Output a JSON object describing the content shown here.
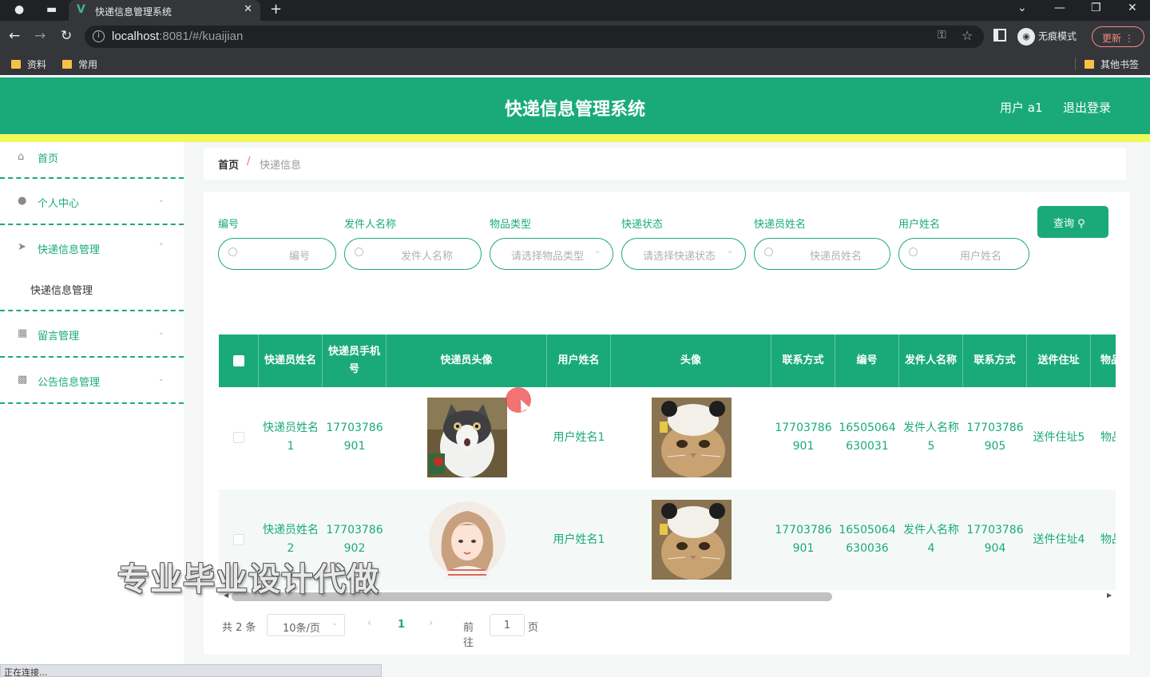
{
  "browser": {
    "tab_title": "快递信息管理系统",
    "tab_icon": "vue-logo-icon",
    "new_tab": "+",
    "url_host": "localhost",
    "url_rest": ":8081/#/kuaijian",
    "incognito_label": "无痕模式",
    "update_label": "更新",
    "bookmarks": [
      "资料",
      "常用"
    ],
    "other_bookmarks": "其他书签",
    "status_text": "正在连接..."
  },
  "app": {
    "title": "快递信息管理系统",
    "user_label": "用户 a1",
    "logout_label": "退出登录",
    "accent_color": "#1aaa7a",
    "highlight_color": "#f1f85a"
  },
  "sidebar": {
    "items": [
      {
        "label": "首页",
        "icon": "home-icon"
      },
      {
        "label": "个人中心",
        "icon": "user-icon"
      },
      {
        "label": "快递信息管理",
        "icon": "send-icon"
      },
      {
        "label": "留言管理",
        "icon": "chat-icon"
      },
      {
        "label": "公告信息管理",
        "icon": "notice-icon"
      }
    ],
    "sub_item": "快递信息管理"
  },
  "breadcrumb": {
    "home": "首页",
    "separator": "/",
    "current": "快递信息"
  },
  "filters": [
    {
      "label": "编号",
      "placeholder": "编号",
      "type": "input"
    },
    {
      "label": "发件人名称",
      "placeholder": "发件人名称",
      "type": "input"
    },
    {
      "label": "物品类型",
      "placeholder": "请选择物品类型",
      "type": "select"
    },
    {
      "label": "快递状态",
      "placeholder": "请选择快递状态",
      "type": "select"
    },
    {
      "label": "快递员姓名",
      "placeholder": "快递员姓名",
      "type": "input"
    },
    {
      "label": "用户姓名",
      "placeholder": "用户姓名",
      "type": "input"
    }
  ],
  "search_button": "查询",
  "table": {
    "headers": [
      "快递员姓名",
      "快递员手机号",
      "快递员头像",
      "用户姓名",
      "头像",
      "联系方式",
      "编号",
      "发件人名称",
      "联系方式",
      "送件住址",
      "物品"
    ],
    "rows": [
      {
        "courier_name": "快递员姓名1",
        "courier_phone": "17703786901",
        "courier_avatar": "cat-photo",
        "user_name": "用户姓名1",
        "avatar": "cat-with-hat-photo",
        "contact": "17703786901",
        "number": "16505064630031",
        "sender": "发件人名称5",
        "sender_contact": "17703786905",
        "address": "送件住址5",
        "item": "物品"
      },
      {
        "courier_name": "快递员姓名2",
        "courier_phone": "17703786902",
        "courier_avatar": "anime-girl-portrait",
        "user_name": "用户姓名1",
        "avatar": "cat-with-hat-photo",
        "contact": "17703786901",
        "number": "16505064630036",
        "sender": "发件人名称4",
        "sender_contact": "17703786904",
        "address": "送件住址4",
        "item": "物品"
      }
    ]
  },
  "pagination": {
    "total": "共 2 条",
    "page_size": "10条/页",
    "current_page": "1",
    "goto_label": "前往",
    "goto_value": "1",
    "page_unit": "页"
  },
  "watermark": "专业毕业设计代做"
}
